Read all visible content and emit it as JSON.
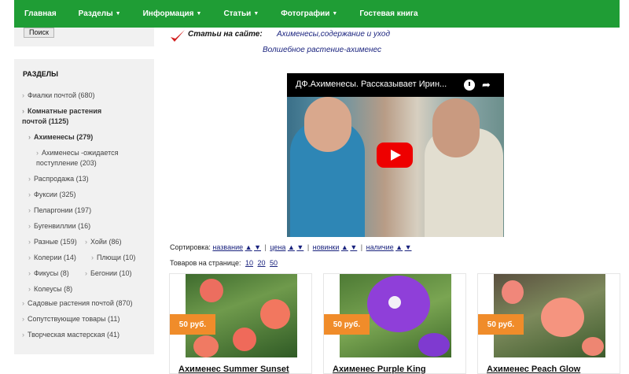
{
  "nav": {
    "items": [
      {
        "label": "Главная",
        "dropdown": false
      },
      {
        "label": "Разделы",
        "dropdown": true
      },
      {
        "label": "Информация",
        "dropdown": true
      },
      {
        "label": "Статьи",
        "dropdown": true
      },
      {
        "label": "Фотографии",
        "dropdown": true
      },
      {
        "label": "Гостевая книга",
        "dropdown": false
      }
    ]
  },
  "search": {
    "button_label": "Поиск"
  },
  "sidebar": {
    "title": "РАЗДЕЛЫ",
    "categories": [
      "Фиалки почтой (680)",
      "Комнатные растения почтой (1125)",
      "Ахименесы (279)",
      "Ахименесы -ожидается поступление (203)",
      "Распродажа (13)",
      "Фуксии (325)",
      "Пеларгонии (197)",
      "Бугенвиллии (16)",
      "Разные (159)",
      "Хойи (86)",
      "Колерии (14)",
      "Плющи (10)",
      "Фикусы (8)",
      "Бегонии (10)",
      "Колеусы (8)",
      "Садовые растения почтой (870)",
      "Сопутствующие товары (11)",
      "Творческая мастерская (41)"
    ]
  },
  "articles": {
    "label": "Статьи на сайте:",
    "links": [
      "Ахименесы,содержание и уход",
      "Волшебное растение-ахименес"
    ]
  },
  "video": {
    "title": "ДФ.Ахименесы. Рассказывает Ирин..."
  },
  "sorting": {
    "label": "Сортировка:",
    "options": [
      "название",
      "цена",
      "новинки",
      "наличие"
    ],
    "up": "▲",
    "down": "▼",
    "separator": "|"
  },
  "per_page": {
    "label": "Товаров на странице:",
    "options": [
      "10",
      "20",
      "50"
    ]
  },
  "products": [
    {
      "title": "Ахименес Summer Sunset",
      "price": "50 руб."
    },
    {
      "title": "Ахименес Purple King",
      "price": "50 руб."
    },
    {
      "title": "Ахименес Peach Glow",
      "price": "50 руб."
    }
  ],
  "colors": {
    "nav_bg": "#1f9d35",
    "price_bg": "#f08c2a",
    "link": "#1a237e"
  }
}
